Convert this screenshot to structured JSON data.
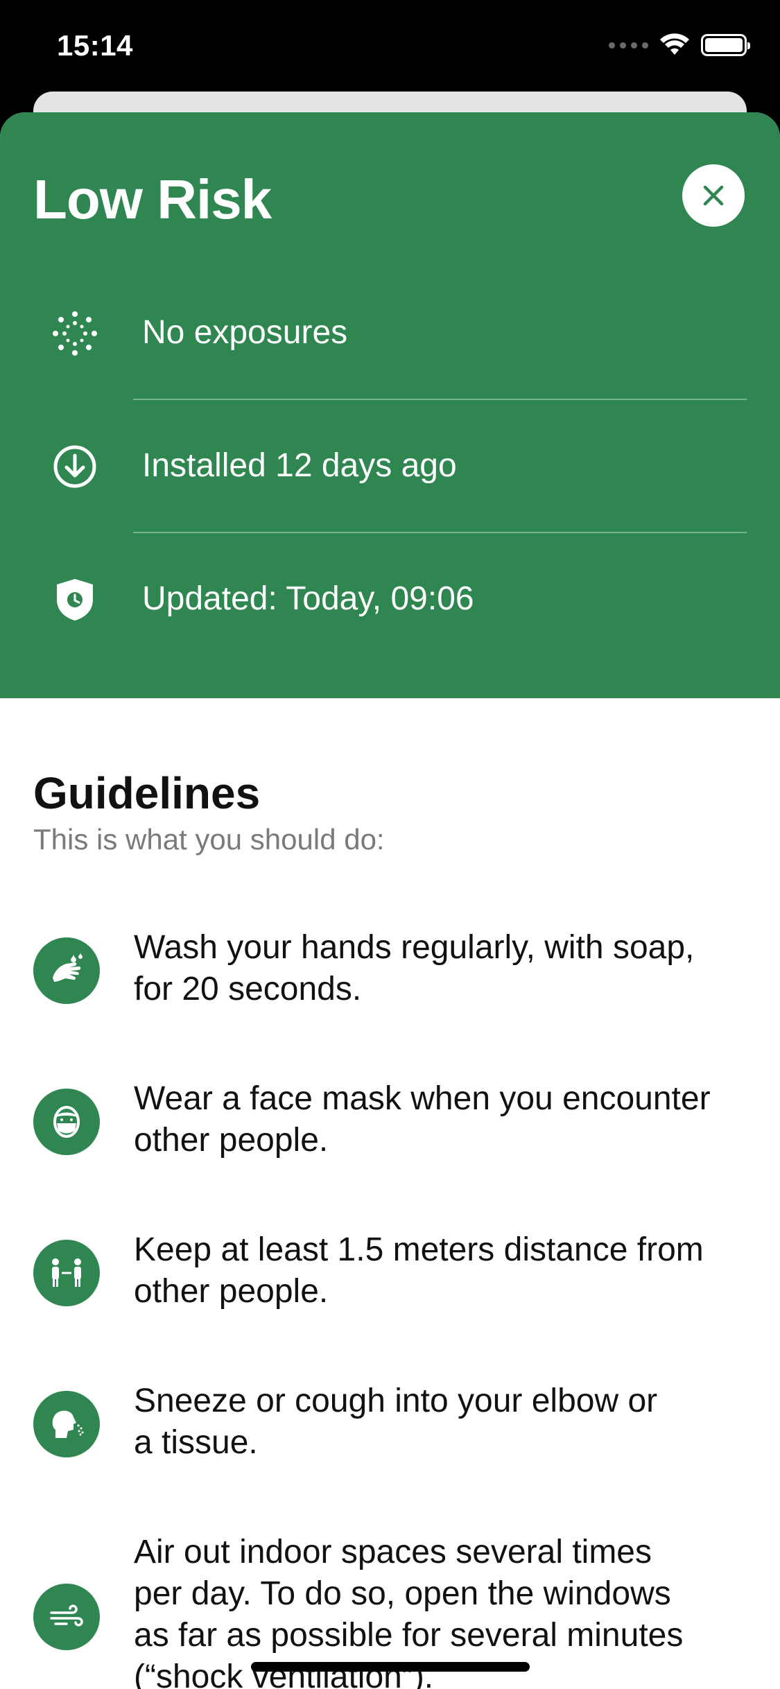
{
  "status_bar": {
    "time": "15:14"
  },
  "risk": {
    "title": "Low Risk",
    "accent_color": "#2f8650",
    "rows": [
      {
        "icon": "virus-dots-icon",
        "label": "No exposures"
      },
      {
        "icon": "download-circle-icon",
        "label": "Installed 12 days ago"
      },
      {
        "icon": "shield-clock-icon",
        "label": "Updated: Today, 09:06"
      }
    ]
  },
  "guidelines": {
    "title": "Guidelines",
    "subtitle": "This is what you should do:",
    "items": [
      {
        "icon": "wash-hands-icon",
        "line1": "Wash your hands regularly, with soap,",
        "line2": "for 20 seconds."
      },
      {
        "icon": "face-mask-icon",
        "line1": "Wear a face mask when you encounter",
        "line2": "other people."
      },
      {
        "icon": "distance-people-icon",
        "line1": "Keep at least 1.5 meters distance from",
        "line2": "other people."
      },
      {
        "icon": "sneeze-elbow-icon",
        "line1": "Sneeze or cough into your elbow or",
        "line2": "a tissue."
      },
      {
        "icon": "ventilation-wind-icon",
        "line1": "Air out indoor spaces several times",
        "line2": "per day. To do so, open the windows",
        "line3": "as far as possible for several minutes",
        "line4": "(“shock ventilation”)."
      }
    ]
  }
}
